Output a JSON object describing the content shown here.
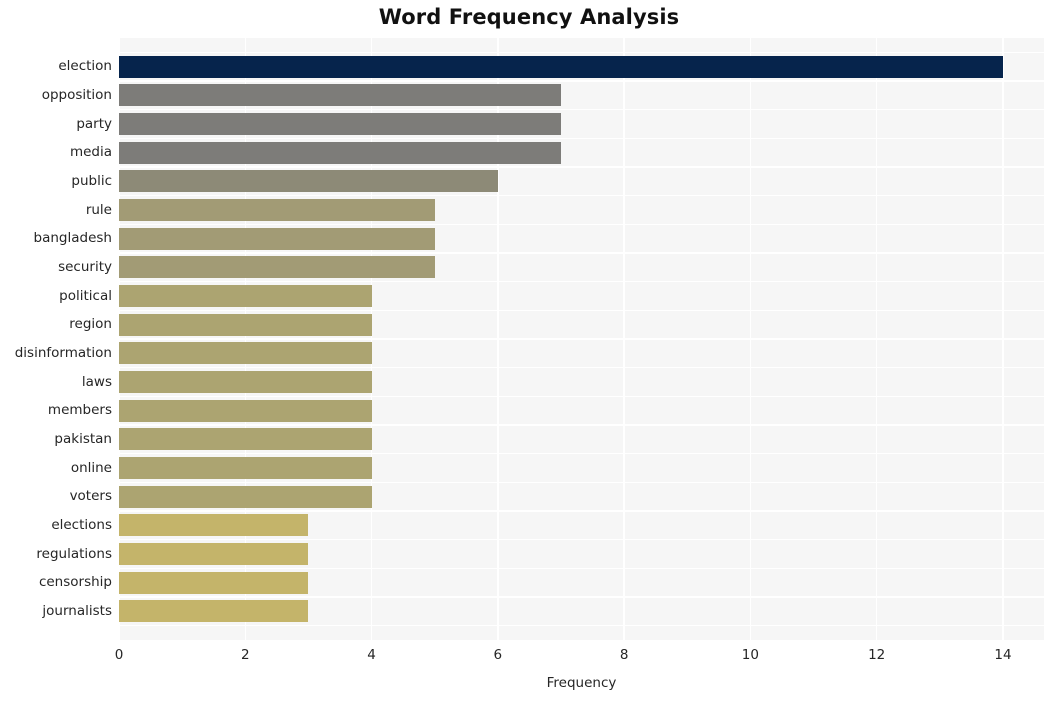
{
  "chart_data": {
    "type": "bar",
    "orientation": "horizontal",
    "title": "Word Frequency Analysis",
    "xlabel": "Frequency",
    "ylabel": "",
    "xlim": [
      0,
      14.65
    ],
    "xticks": [
      0,
      2,
      4,
      6,
      8,
      10,
      12,
      14
    ],
    "xtick_labels": [
      "0",
      "2",
      "4",
      "6",
      "8",
      "10",
      "12",
      "14"
    ],
    "grid": true,
    "legend": null,
    "categories": [
      "election",
      "opposition",
      "party",
      "media",
      "public",
      "rule",
      "bangladesh",
      "security",
      "political",
      "region",
      "disinformation",
      "laws",
      "members",
      "pakistan",
      "online",
      "voters",
      "elections",
      "regulations",
      "censorship",
      "journalists"
    ],
    "values": [
      14,
      7,
      7,
      7,
      6,
      5,
      5,
      5,
      4,
      4,
      4,
      4,
      4,
      4,
      4,
      4,
      3,
      3,
      3,
      3
    ],
    "bar_colors": [
      "#06244c",
      "#7d7c79",
      "#7d7c79",
      "#7d7c79",
      "#8d8a77",
      "#a29b75",
      "#a29b75",
      "#a29b75",
      "#aca471",
      "#aca471",
      "#aca471",
      "#aca471",
      "#aca471",
      "#aca471",
      "#aca471",
      "#aca471",
      "#c4b46a",
      "#c4b46a",
      "#c4b46a",
      "#c4b46a"
    ]
  },
  "style": {
    "plot_background": "#f6f6f6",
    "page_background": "#ffffff",
    "gridline_color": "#ffffff",
    "text_color": "#262626",
    "title_color": "#111111"
  }
}
